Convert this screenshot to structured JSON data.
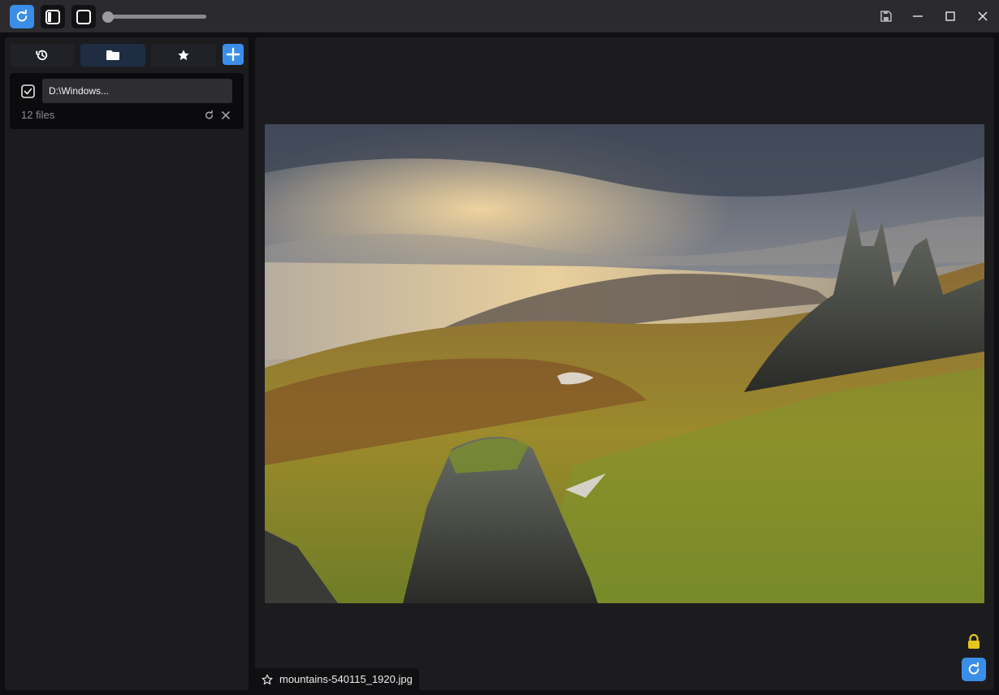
{
  "titlebar": {
    "refresh_icon": "refresh-icon",
    "panel_icon": "sidebar-toggle-icon",
    "square_icon": "fullscreen-icon",
    "zoom_slider_value": 0,
    "save_icon": "save-icon",
    "minimize_icon": "minimize-icon",
    "maximize_icon": "maximize-icon",
    "close_icon": "close-icon"
  },
  "sidebar": {
    "tabs": [
      {
        "icon": "history-icon",
        "active": false
      },
      {
        "icon": "folder-icon",
        "active": true
      },
      {
        "icon": "star-icon",
        "active": false
      }
    ],
    "add_icon": "plus-icon",
    "folder": {
      "checked": true,
      "path": "D:\\Windows...",
      "count": "12 files"
    }
  },
  "viewer": {
    "filename": "mountains-540115_1920.jpg",
    "favorite_icon": "star-outline-icon",
    "lock_icon": "lock-icon",
    "lock_color": "#e3c81a",
    "refresh_icon": "refresh-icon"
  },
  "colors": {
    "accent": "#3b8ee8",
    "titlebar": "#2b2b2f",
    "panel": "#1c1c1f"
  }
}
